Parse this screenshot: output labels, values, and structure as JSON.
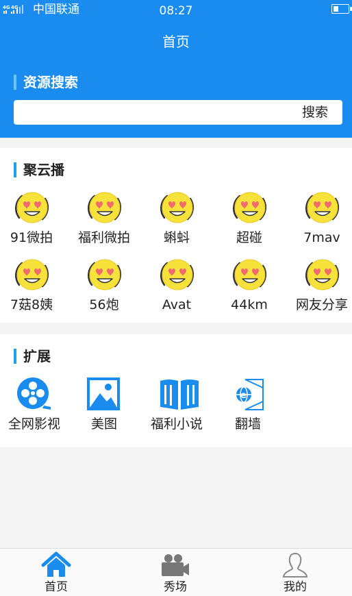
{
  "status_bar": {
    "network": "4G 4G",
    "carrier": "中国联通",
    "time": "08:27"
  },
  "header": {
    "title": "首页"
  },
  "search": {
    "section_title": "资源搜索",
    "placeholder": "",
    "button_label": "搜索"
  },
  "cloud": {
    "section_title": "聚云播",
    "items": [
      {
        "label": "91微拍",
        "icon": "heart-eyes-emoji-icon"
      },
      {
        "label": "福利微拍",
        "icon": "heart-eyes-emoji-icon"
      },
      {
        "label": "蝌蚪",
        "icon": "heart-eyes-emoji-icon"
      },
      {
        "label": "超碰",
        "icon": "heart-eyes-emoji-icon"
      },
      {
        "label": "7mav",
        "icon": "heart-eyes-emoji-icon"
      },
      {
        "label": "7菇8姨",
        "icon": "heart-eyes-emoji-icon"
      },
      {
        "label": "56炮",
        "icon": "heart-eyes-emoji-icon"
      },
      {
        "label": "Avat",
        "icon": "heart-eyes-emoji-icon"
      },
      {
        "label": "44km",
        "icon": "heart-eyes-emoji-icon"
      },
      {
        "label": "网友分享",
        "icon": "heart-eyes-emoji-icon"
      }
    ]
  },
  "extension": {
    "section_title": "扩展",
    "items": [
      {
        "label": "全网影视",
        "icon": "film-reel-icon"
      },
      {
        "label": "美图",
        "icon": "image-icon"
      },
      {
        "label": "福利小说",
        "icon": "book-icon"
      },
      {
        "label": "翻墙",
        "icon": "browser-globe-icon"
      }
    ]
  },
  "bottom_nav": {
    "items": [
      {
        "label": "首页",
        "icon": "home-icon"
      },
      {
        "label": "秀场",
        "icon": "video-camera-icon"
      },
      {
        "label": "我的",
        "icon": "user-icon"
      }
    ]
  },
  "colors": {
    "primary": "#1a8cf0",
    "accent_bar": "#1aa3ee",
    "emoji_yellow": "#f7e13b",
    "emoji_heart": "#f06b6b"
  }
}
